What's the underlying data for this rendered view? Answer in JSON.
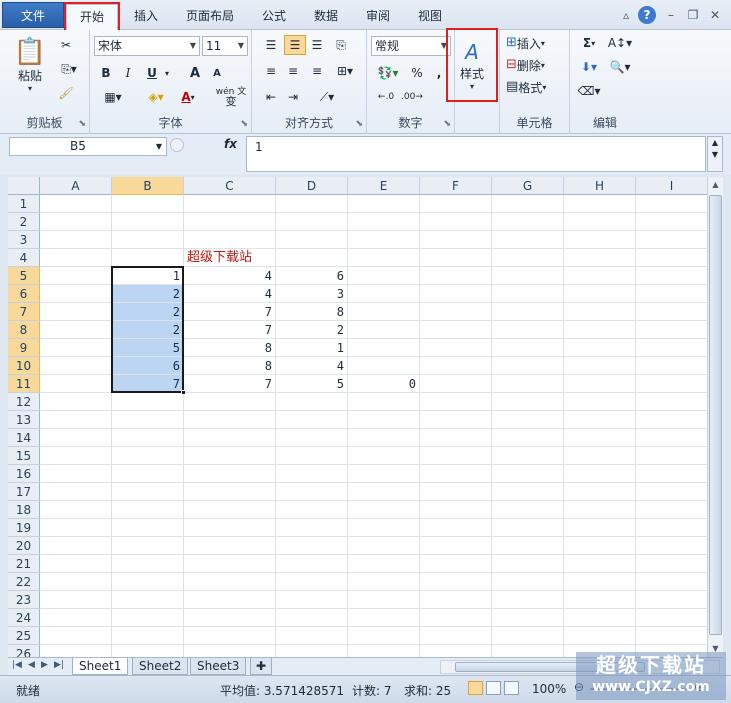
{
  "ribbon_tabs": [
    "文件",
    "开始",
    "插入",
    "页面布局",
    "公式",
    "数据",
    "审阅",
    "视图"
  ],
  "clipboard": {
    "paste": "粘贴",
    "label": "剪贴板"
  },
  "font": {
    "name": "宋体",
    "size": "11",
    "label": "字体",
    "bold": "B",
    "italic": "I",
    "underline": "U",
    "grow": "A",
    "shrink": "A",
    "wen": "wén 文",
    "wen_under": "变",
    "font_color": "A"
  },
  "alignment": {
    "label": "对齐方式"
  },
  "number": {
    "format": "常规",
    "label": "数字",
    "percent": "%",
    "comma": ","
  },
  "styles": {
    "label": "样式"
  },
  "cells": {
    "insert": "插入",
    "delete": "删除",
    "format": "格式",
    "label": "单元格"
  },
  "editing": {
    "label": "编辑",
    "sum": "Σ"
  },
  "formula_bar": {
    "name_box": "B5",
    "fx": "fx",
    "value": "1"
  },
  "columns": [
    "A",
    "B",
    "C",
    "D",
    "E",
    "F",
    "G",
    "H",
    "I"
  ],
  "rows": [
    "1",
    "2",
    "3",
    "4",
    "5",
    "6",
    "7",
    "8",
    "9",
    "10",
    "11",
    "12",
    "13",
    "14",
    "15",
    "16",
    "17",
    "18",
    "19",
    "20",
    "21",
    "22",
    "23",
    "24",
    "25",
    "26"
  ],
  "annotation_text": "超级下载站",
  "cells_data": {
    "B": [
      "1",
      "2",
      "2",
      "2",
      "5",
      "6",
      "7"
    ],
    "C": [
      "4",
      "4",
      "7",
      "7",
      "8",
      "8",
      "7"
    ],
    "D": [
      "6",
      "3",
      "8",
      "2",
      "1",
      "4",
      "5"
    ],
    "E11": "0"
  },
  "sheets": [
    "Sheet1",
    "Sheet2",
    "Sheet3"
  ],
  "status": {
    "ready": "就绪",
    "average": "平均值: 3.571428571",
    "count": "计数: 7",
    "sum": "求和: 25",
    "zoom": "100%"
  },
  "watermark": {
    "title": "超级下载站",
    "url": "www.CJXZ.com"
  },
  "highlight_color": "#e02020",
  "selection_color": "#bcd5f2"
}
